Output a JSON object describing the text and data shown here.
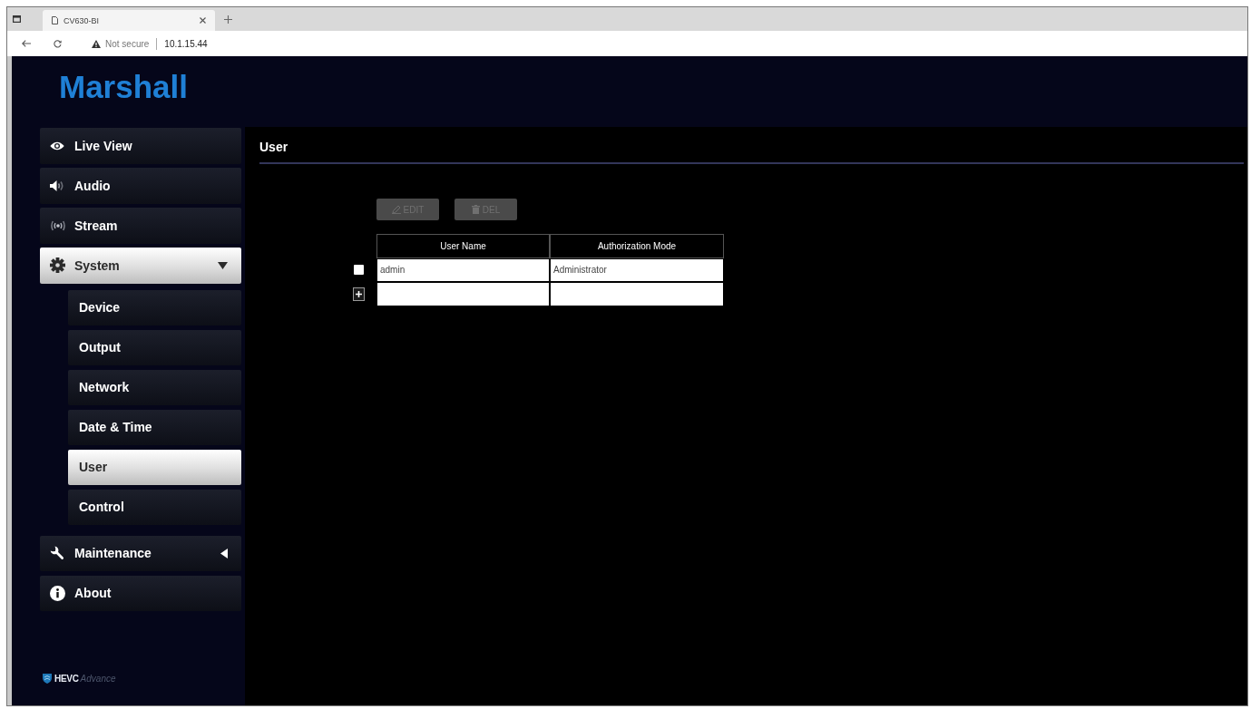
{
  "browser": {
    "tab": {
      "title": "CV630-BI"
    },
    "address_bar": {
      "security": "Not secure",
      "url": "10.1.15.44"
    }
  },
  "header": {
    "logo": "Marshall"
  },
  "sidebar": {
    "items": [
      {
        "label": "Live View",
        "selected": false
      },
      {
        "label": "Audio",
        "selected": false
      },
      {
        "label": "Stream",
        "selected": false
      },
      {
        "label": "System",
        "selected": true,
        "expanded": true,
        "children": [
          {
            "label": "Device",
            "selected": false
          },
          {
            "label": "Output",
            "selected": false
          },
          {
            "label": "Network",
            "selected": false
          },
          {
            "label": "Date & Time",
            "selected": false
          },
          {
            "label": "User",
            "selected": true
          },
          {
            "label": "Control",
            "selected": false
          }
        ]
      },
      {
        "label": "Maintenance",
        "selected": false,
        "expanded": false
      },
      {
        "label": "About",
        "selected": false
      }
    ],
    "footer_logo": {
      "mark": "HEVC",
      "tagline": "Advance"
    }
  },
  "content": {
    "title": "User",
    "toolbar": [
      {
        "label": "EDIT",
        "disabled": true
      },
      {
        "label": "DEL",
        "disabled": true
      }
    ],
    "table": {
      "columns": [
        "User Name",
        "Authorization Mode"
      ],
      "rows": [
        {
          "checked": false,
          "cells": [
            "admin",
            "Administrator"
          ]
        }
      ],
      "add_row": true
    }
  }
}
